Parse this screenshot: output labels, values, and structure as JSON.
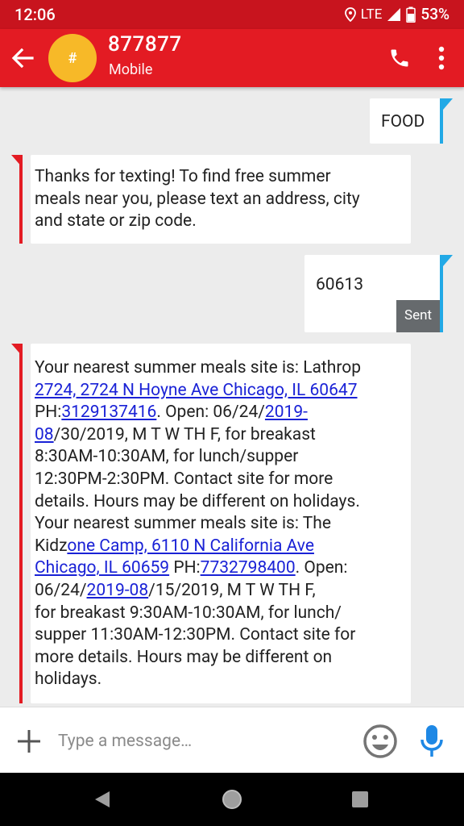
{
  "status_bar": {
    "time": "12:06",
    "network": "LTE",
    "battery": "53%"
  },
  "header": {
    "avatar_glyph": "#",
    "contact_number": "877877",
    "contact_type": "Mobile",
    "icons": [
      "back-arrow-icon",
      "phone-icon",
      "more-vert-icon"
    ]
  },
  "messages": [
    {
      "direction": "outgoing",
      "text": "FOOD"
    },
    {
      "direction": "incoming",
      "lines": [
        "Thanks for texting! To find free summer",
        "meals near you, please text an address, city",
        "and state or zip code."
      ]
    },
    {
      "direction": "outgoing",
      "text": "60613",
      "status": "Sent"
    },
    {
      "direction": "incoming",
      "line1": "Your nearest summer meals site is: Lathrop",
      "link_address_1": "2724, 2724 N Hoyne Ave Chicago, IL 60647",
      "ph_label_1": "PH:",
      "link_phone_1": "3129137416",
      "open_text_1": ". Open: 06/24/",
      "link_date_1a": "2019-",
      "link_date_1b": "08",
      "date_rest_1": "/30/2019, M T W TH F, for breakast",
      "line_hours_1a": "8:30AM-10:30AM, for lunch/supper",
      "line_hours_1b": "12:30PM-2:30PM. Contact site for more",
      "line_details_1": "details. Hours may be different on holidays.",
      "line_site_2": "Your nearest summer meals site is: The",
      "kidz_prefix": "Kidz",
      "link_address_2a": "one Camp, 6110 N California Ave",
      "link_address_2b": "Chicago, IL 60659",
      "ph_label_2": " PH:",
      "link_phone_2": "7732798400",
      "open_text_2": ". Open:",
      "date_prefix_2": "06/24/",
      "link_date_2": "2019-08",
      "date_rest_2": "/15/2019, M T W TH F,",
      "line_hours_2a": "for breakast 9:30AM-10:30AM, for lunch/",
      "line_hours_2b": "supper 11:30AM-12:30PM. Contact site for",
      "line_details_2a": "more details. Hours may be different on",
      "line_details_2b": "holidays."
    }
  ],
  "compose": {
    "placeholder": "Type a message…",
    "icons": [
      "plus-icon",
      "emoji-icon",
      "microphone-icon"
    ]
  },
  "colors": {
    "status_bar": "#c8141e",
    "app_bar": "#e31b23",
    "avatar": "#f7b928",
    "outgoing_accent": "#22a9e6",
    "incoming_accent": "#e31b23",
    "link": "#1a22d6",
    "sent_badge": "#666a6d",
    "mic": "#1e88e5"
  },
  "nav_bar": {
    "icons": [
      "back-triangle-icon",
      "home-circle-icon",
      "recents-square-icon"
    ]
  }
}
